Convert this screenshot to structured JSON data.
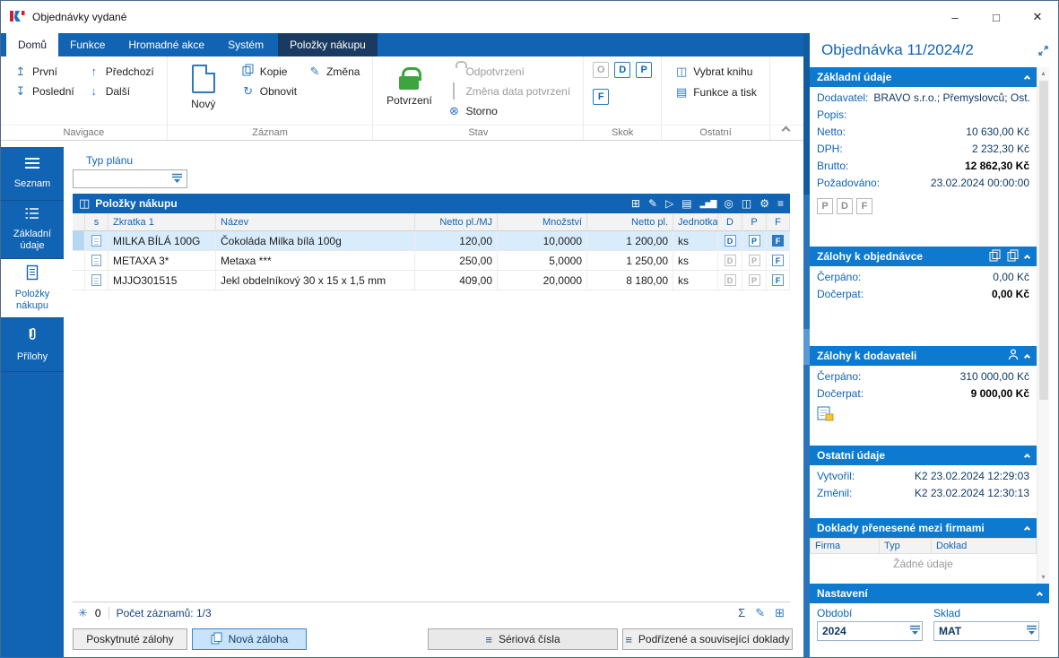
{
  "window": {
    "title": "Objednávky vydané"
  },
  "titlebar_controls": {
    "minimize": "–",
    "maximize": "□",
    "close": "✕"
  },
  "ribbon": {
    "tabs": [
      "Domů",
      "Funkce",
      "Hromadné akce",
      "Systém",
      "Položky nákupu"
    ],
    "groups": {
      "navigace": {
        "label": "Navigace",
        "first": "První",
        "last": "Poslední",
        "prev": "Předchozí",
        "next": "Další"
      },
      "zaznam": {
        "label": "Záznam",
        "new": "Nový",
        "copy": "Kopie",
        "change": "Změna",
        "refresh": "Obnovit"
      },
      "stav": {
        "label": "Stav",
        "confirm": "Potvrzení",
        "unconfirm": "Odpotvrzení",
        "change_date": "Změna data potvrzení",
        "storno": "Storno"
      },
      "skok": {
        "label": "Skok",
        "o": "O",
        "d": "D",
        "p": "P",
        "f": "F"
      },
      "ostatni": {
        "label": "Ostatní",
        "pick_book": "Vybrat knihu",
        "functions_print": "Funkce a tisk"
      }
    },
    "icons": {
      "first": "↥",
      "last": "↧",
      "prev": "↑",
      "next": "↓",
      "change": "✎",
      "refresh": "↻",
      "storno": "⊗",
      "pick_book": "◫",
      "print": "▤"
    }
  },
  "sidebar": {
    "items": [
      {
        "label": "Seznam"
      },
      {
        "label": "Základní údaje"
      },
      {
        "label": "Položky nákupu"
      },
      {
        "label": "Přílohy"
      }
    ]
  },
  "main": {
    "plan_type_label": "Typ plánu",
    "grid": {
      "title": "Položky nákupu",
      "icons": {
        "book": "◫",
        "import": "⊞",
        "edit": "✎",
        "run": "▷",
        "print": "▤",
        "chart": "▂▅▇",
        "search": "◎",
        "columns": "◫",
        "settings": "⚙",
        "menu": "≡"
      },
      "columns": {
        "s": "s",
        "zkratka": "Zkratka 1",
        "nazev": "Název",
        "netto_mj": "Netto pl./MJ",
        "mnozstvi": "Množství",
        "netto": "Netto pl.",
        "jednotka": "Jednotka",
        "d": "D",
        "p": "P",
        "f": "F"
      },
      "rows": [
        {
          "zkratka": "MILKA BÍLÁ 100G",
          "nazev": "Čokoláda Milka bílá 100g",
          "netto_mj": "120,00",
          "mnozstvi": "10,0000",
          "netto": "1 200,00",
          "jednotka": "ks",
          "d": "D",
          "p": "P",
          "f": "F"
        },
        {
          "zkratka": "METAXA 3*",
          "nazev": "Metaxa ***",
          "netto_mj": "250,00",
          "mnozstvi": "5,0000",
          "netto": "1 250,00",
          "jednotka": "ks",
          "d": "D",
          "p": "P",
          "f": "F"
        },
        {
          "zkratka": "MJJO301515",
          "nazev": "Jekl obdelníkový 30 x 15 x 1,5 mm",
          "netto_mj": "409,00",
          "mnozstvi": "20,0000",
          "netto": "8 180,00",
          "jednotka": "ks",
          "d": "D",
          "p": "P",
          "f": "F"
        }
      ],
      "status": {
        "changes": "0",
        "records": "Počet záznamů: 1/3"
      },
      "status_icons": {
        "star": "✳",
        "sum": "Σ",
        "edit": "✎",
        "table_edit": "⊞"
      }
    },
    "buttons": {
      "provided": "Poskytnuté zálohy",
      "new_deposit": "Nová záloha",
      "serial": "Sériová čísla",
      "subordinate": "Podřízené a související doklady"
    }
  },
  "panel": {
    "title": "Objednávka 11/2024/2",
    "scroll_icons": {
      "up": "▴",
      "down": "▾"
    },
    "zakladni": {
      "title": "Základní údaje",
      "supplier_label": "Dodavatel:",
      "supplier": "BRAVO s.r.o.; Přemyslovců; Ost...",
      "popis_label": "Popis:",
      "popis": "",
      "netto_label": "Netto:",
      "netto": "10 630,00 Kč",
      "dph_label": "DPH:",
      "dph": "2 232,30 Kč",
      "brutto_label": "Brutto:",
      "brutto": "12 862,30 Kč",
      "pozadovano_label": "Požadováno:",
      "pozadovano": "23.02.2024 00:00:00",
      "flags": {
        "p": "P",
        "d": "D",
        "f": "F"
      }
    },
    "zalohy_obj": {
      "title": "Zálohy k objednávce",
      "cerpano_label": "Čerpáno:",
      "cerpano": "0,00 Kč",
      "docerpat_label": "Dočerpat:",
      "docerpat": "0,00 Kč"
    },
    "zalohy_dod": {
      "title": "Zálohy k dodavateli",
      "cerpano_label": "Čerpáno:",
      "cerpano": "310 000,00 Kč",
      "docerpat_label": "Dočerpat:",
      "docerpat": "9 000,00 Kč"
    },
    "ostatni": {
      "title": "Ostatní údaje",
      "vytvoril_label": "Vytvořil:",
      "vytvoril": "K2 23.02.2024 12:29:03",
      "zmenil_label": "Změnil:",
      "zmenil": "K2 23.02.2024 12:30:13"
    },
    "doklady": {
      "title": "Doklady přenesené mezi firmami",
      "columns": [
        "Firma",
        "Typ",
        "Doklad"
      ],
      "empty": "Žádné údaje"
    },
    "nastaveni": {
      "title": "Nastavení",
      "obdobi_label": "Období",
      "obdobi": "2024",
      "sklad_label": "Sklad",
      "sklad": "MAT"
    }
  }
}
